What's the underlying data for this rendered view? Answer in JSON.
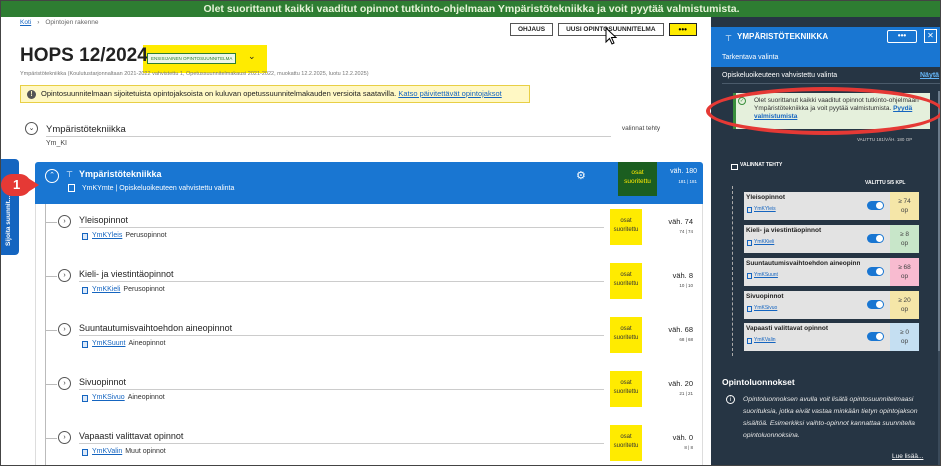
{
  "banner": {
    "text": "Olet suorittanut kaikki vaaditut opinnot tutkinto-ohjelmaan Ympäristötekniikka ja voit pyytää valmistumista."
  },
  "breadcrumb": {
    "home": "Koti",
    "current": "Opintojen rakenne"
  },
  "toolbar": {
    "guidance": "OHJAUS",
    "new_plan": "UUSI OPINTOSUUNNITELMA",
    "more": "•••"
  },
  "header": {
    "title": "HOPS 12/2024",
    "status": "ENSISIJAINEN OPINTOSUUNNITELMA",
    "subtitle": "Ympäristötekniikka (Koulutustarjonnaltaan 2021-2022 vahvistettu 1, Opetussuunnitelmakausi 2021-2022, muokattu 12.2.2025, luotu 12.2.2025)"
  },
  "alert": {
    "text": "Opintosuunnitelmaan sijoitetuista opintojaksoista on kuluvan opetussuunnitelmakauden versioita saatavilla.",
    "link": "Katso päivitettävät opintojaksot"
  },
  "root": {
    "title": "Ympäristötekniikka",
    "code": "Ym_KI",
    "chosen_label": "valinnat tehty"
  },
  "side_tab": {
    "label": "Sijoita suunnit..."
  },
  "step_marker": {
    "number": "1"
  },
  "module": {
    "title": "Ympäristötekniikka",
    "code_line": "YmKYmte | Opiskeluoikeuteen vahvistettu valinta",
    "badge": "osat suoritettu",
    "credit_min": "väh. 180",
    "credit_done": "181 | 181"
  },
  "items": [
    {
      "title": "Yleisopinnot",
      "code": "YmKYleis",
      "type": "Perusopinnot",
      "badge": "osat suoritettu",
      "credit_min": "väh. 74",
      "credit_done": "74 | 74"
    },
    {
      "title": "Kieli- ja viestintäopinnot",
      "code": "YmKKieli",
      "type": "Perusopinnot",
      "badge": "osat suoritettu",
      "credit_min": "väh. 8",
      "credit_done": "10 | 10"
    },
    {
      "title": "Suuntautumisvaihtoehdon aineopinnot",
      "code": "YmKSuunt",
      "type": "Aineopinnot",
      "badge": "osat suoritettu",
      "credit_min": "väh. 68",
      "credit_done": "68 | 68"
    },
    {
      "title": "Sivuopinnot",
      "code": "YmKSivuo",
      "type": "Aineopinnot",
      "badge": "osat suoritettu",
      "credit_min": "väh. 20",
      "credit_done": "21 | 21"
    },
    {
      "title": "Vapaasti valittavat opinnot",
      "code": "YmKValin",
      "type": "Muut opinnot",
      "badge": "osat suoritettu",
      "credit_min": "väh. 0",
      "credit_done": "8 | 8"
    }
  ],
  "panel": {
    "title": "YMPÄRISTÖTEKNIIKKA",
    "more": "•••",
    "close": "✕",
    "sub1": "Tarkentava valinta",
    "sub2": "Opiskeluoikeuteen vahvistettu valinta",
    "sub2_link": "Näytä",
    "success_text": "Olet suorittanut kaikki vaaditut opinnot tutkinto-ohjelmaan Ympäristötekniikka ja voit pyytää valmistumista.",
    "success_link": "Pyydä valmistumista",
    "chosen_total": "VALITTU 181/VÄH. 180 OP",
    "chosen_button": "VALINNAT TEHTY",
    "chosen_count": "VALITTU 5/5 KPL",
    "items": [
      {
        "name": "Yleisopinnot",
        "code": "YmKYleis",
        "value": "≥ 74",
        "unit": "op",
        "color": "#f5e6a8"
      },
      {
        "name": "Kieli- ja viestintäopinnot",
        "code": "YmKKieli",
        "value": "≥ 8",
        "unit": "op",
        "color": "#c8e6c9"
      },
      {
        "name": "Suuntautumisvaihtoehdon aineopinnot",
        "code": "YmKSuunt",
        "value": "≥ 68",
        "unit": "op",
        "color": "#f8bbd0"
      },
      {
        "name": "Sivuopinnot",
        "code": "YmKSivuo",
        "value": "≥ 20",
        "unit": "op",
        "color": "#f5e6a8"
      },
      {
        "name": "Vapaasti valittavat opinnot",
        "code": "YmKValin",
        "value": "≥ 0",
        "unit": "op",
        "color": "#c5dff2"
      }
    ],
    "ol_title": "Opintoluonnokset",
    "ol_text": "Opintoluonnoksen avulla voit lisätä opintosuunnitelmaasi suorituksia, jotka eivät vastaa minkään tietyn opintojakson sisältöä. Esimerkiksi vaihto-opinnot kannattaa suunnitella opintoluonnoksina.",
    "ol_more": "Lue lisää..."
  },
  "colors": {
    "accent": "#1976d2",
    "banner": "#2e7d32",
    "highlight": "#ffeb00",
    "panel_bg": "#263544",
    "step": "#e53935"
  }
}
